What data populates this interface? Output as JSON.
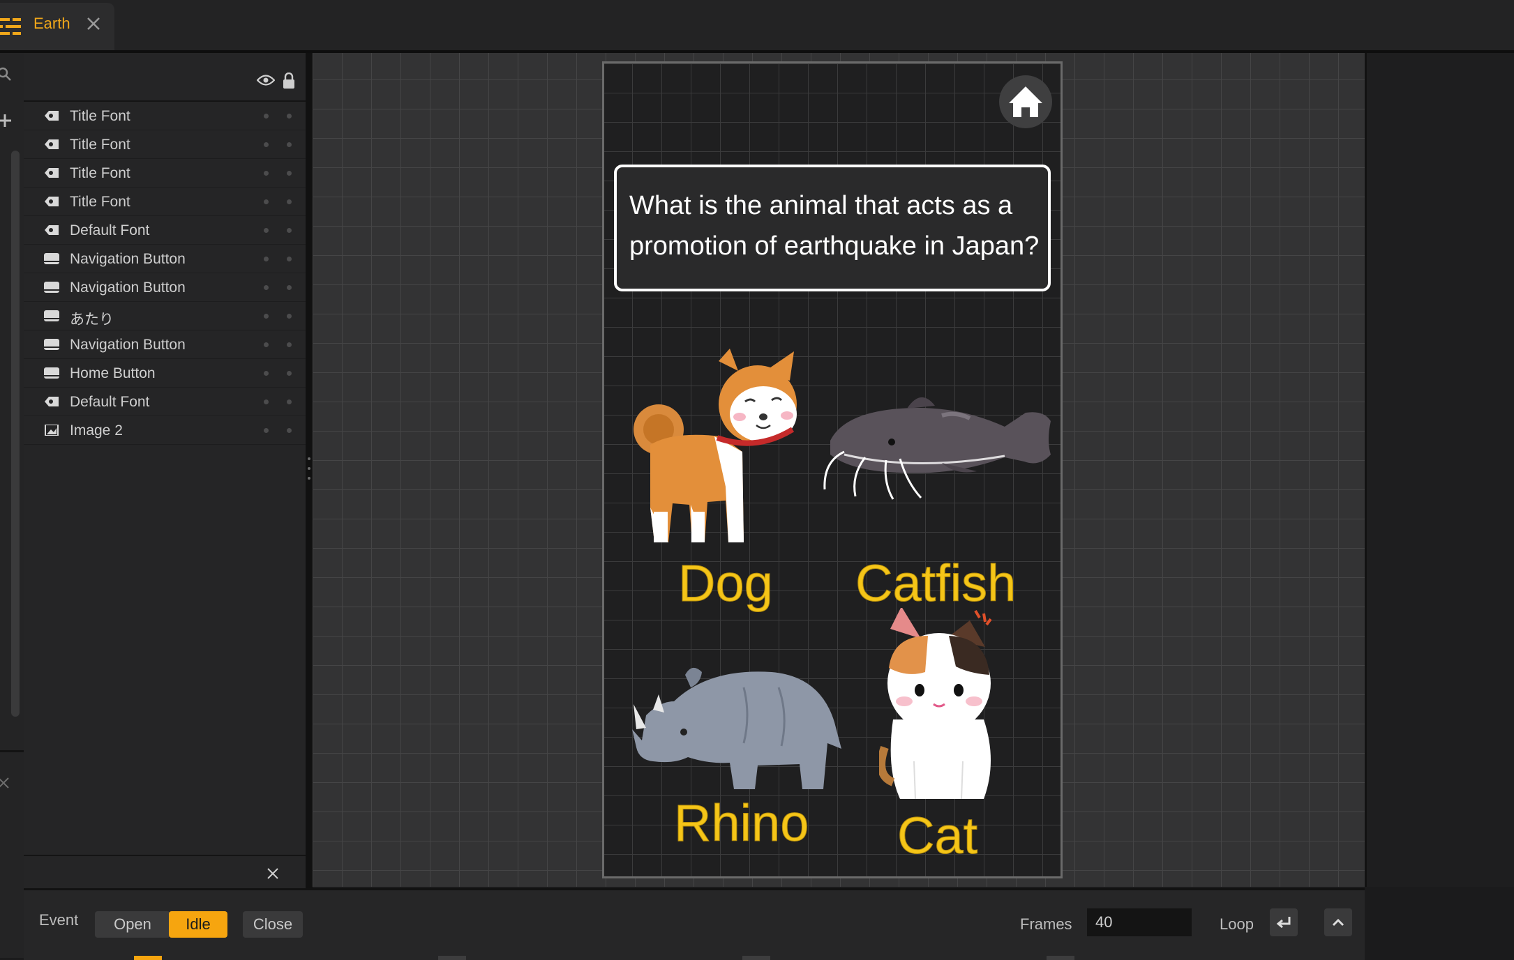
{
  "tab": {
    "title": "Earth",
    "accent": "#f0a71a"
  },
  "layers": {
    "items": [
      {
        "label": "Title Font",
        "icon": "text-layer-icon"
      },
      {
        "label": "Title Font",
        "icon": "text-layer-icon"
      },
      {
        "label": "Title Font",
        "icon": "text-layer-icon"
      },
      {
        "label": "Title Font",
        "icon": "text-layer-icon"
      },
      {
        "label": "Default Font",
        "icon": "text-layer-icon"
      },
      {
        "label": "Navigation Button",
        "icon": "button-layer-icon"
      },
      {
        "label": "Navigation Button",
        "icon": "button-layer-icon"
      },
      {
        "label": "あたり",
        "icon": "button-layer-icon"
      },
      {
        "label": "Navigation Button",
        "icon": "button-layer-icon"
      },
      {
        "label": "Home Button",
        "icon": "button-layer-icon"
      },
      {
        "label": "Default Font",
        "icon": "text-layer-icon"
      },
      {
        "label": "Image 2",
        "icon": "image-layer-icon"
      }
    ]
  },
  "preview": {
    "question": "What is the animal that acts as a promotion of earthquake in Japan?",
    "answers": {
      "dog": "Dog",
      "catfish": "Catfish",
      "rhino": "Rhino",
      "cat": "Cat"
    },
    "answer_color": "#f5c518"
  },
  "eventbar": {
    "event_label": "Event",
    "buttons": {
      "open": "Open",
      "idle": "Idle",
      "close": "Close"
    },
    "active": "Idle",
    "frames_label": "Frames",
    "frames_value": "40",
    "loop_label": "Loop",
    "active_color": "#f6a50f"
  }
}
